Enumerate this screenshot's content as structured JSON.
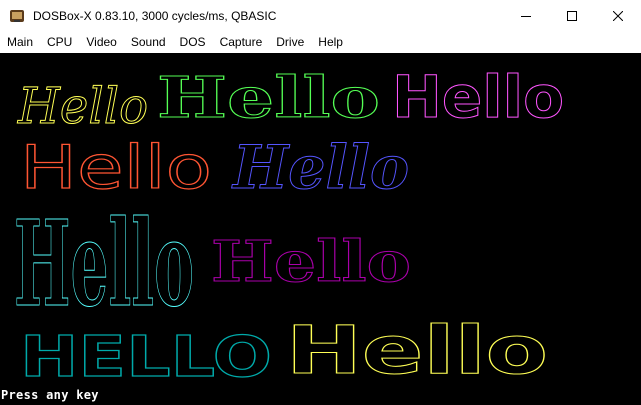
{
  "window": {
    "title": "DOSBox-X 0.83.10, 3000 cycles/ms, QBASIC",
    "icon": "dosbox-icon"
  },
  "menubar": {
    "items": [
      "Main",
      "CPU",
      "Video",
      "Sound",
      "DOS",
      "Capture",
      "Drive",
      "Help"
    ]
  },
  "screen": {
    "background": "#000000",
    "texts": [
      {
        "text": "Hello",
        "color": "#ffff55",
        "style": "blackletter-light"
      },
      {
        "text": "Hello",
        "color": "#55ff55",
        "style": "blackletter-bold"
      },
      {
        "text": "Hello",
        "color": "#ff55ff",
        "style": "sans-outline"
      },
      {
        "text": "Hello",
        "color": "#ff5533",
        "style": "sans-outline"
      },
      {
        "text": "Hello",
        "color": "#5555ff",
        "style": "script-outline"
      },
      {
        "text": "Hello",
        "color": "#55ffff",
        "style": "blackletter-tall"
      },
      {
        "text": "Hello",
        "color": "#aa00aa",
        "style": "blackletter-outline"
      },
      {
        "text": "HELLO",
        "color": "#00aaaa",
        "style": "block-outline"
      },
      {
        "text": "Hello",
        "color": "#ffff55",
        "style": "heavy-outline"
      }
    ],
    "prompt": "Press any key"
  },
  "controls": {
    "minimize": "minimize-icon",
    "maximize": "maximize-icon",
    "close": "close-icon"
  }
}
